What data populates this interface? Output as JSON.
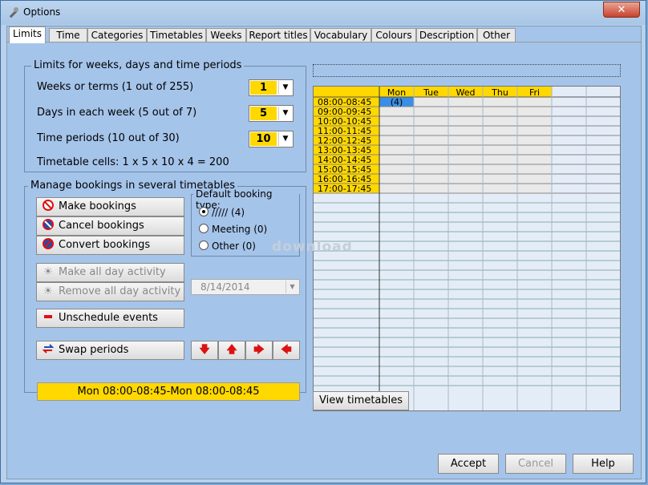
{
  "window": {
    "title": "Options",
    "close_label": "✕"
  },
  "tabs": [
    "Limits",
    "Time",
    "Categories",
    "Timetables",
    "Weeks",
    "Report titles",
    "Vocabulary",
    "Colours",
    "Description",
    "Other"
  ],
  "limits": {
    "group_title": "Limits for weeks, days and time periods",
    "weeks_label": "Weeks or terms (1 out of 255)",
    "weeks_value": "1",
    "days_label": "Days in each week (5 out of 7)",
    "days_value": "5",
    "periods_label": "Time periods (10 out of 30)",
    "periods_value": "10",
    "cells_text": "Timetable cells: 1 x 5 x 10 x 4 = 200"
  },
  "bookings": {
    "group_title": "Manage bookings in several timetables",
    "make": "Make bookings",
    "cancel": "Cancel bookings",
    "convert": "Convert bookings",
    "allday": "Make all day activity",
    "remove_allday": "Remove all day activity",
    "unschedule": "Unschedule events",
    "swap": "Swap periods",
    "default_type_title": "Default booking type:",
    "radio1": "///// (4)",
    "radio2": "Meeting (0)",
    "radio3": "Other (0)",
    "date": "8/14/2014",
    "status": "Mon 08:00-08:45-Mon 08:00-08:45"
  },
  "timetable": {
    "days": [
      "Mon",
      "Tue",
      "Wed",
      "Thu",
      "Fri"
    ],
    "periods": [
      "08:00-08:45",
      "09:00-09:45",
      "10:00-10:45",
      "11:00-11:45",
      "12:00-12:45",
      "13:00-13:45",
      "14:00-14:45",
      "15:00-15:45",
      "16:00-16:45",
      "17:00-17:45"
    ],
    "selected_cell": "(4)",
    "view_button": "View timetables"
  },
  "watermark": "download",
  "footer": {
    "accept": "Accept",
    "cancel": "Cancel",
    "help": "Help"
  },
  "colors": {
    "accent": "#ffd800",
    "selected": "#3a8ee6"
  }
}
